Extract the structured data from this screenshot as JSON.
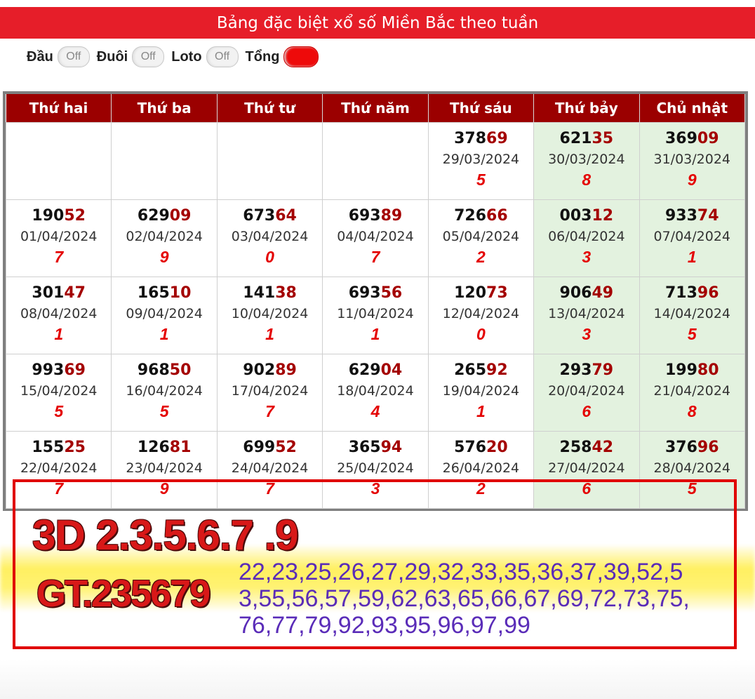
{
  "header": {
    "title": "Bảng đặc biệt xổ số Miền Bắc theo tuần"
  },
  "toggles": [
    {
      "label": "Đầu",
      "state": "Off"
    },
    {
      "label": "Đuôi",
      "state": "Off"
    },
    {
      "label": "Loto",
      "state": "Off"
    },
    {
      "label": "Tổng",
      "state": ""
    }
  ],
  "table": {
    "headers": [
      "Thứ hai",
      "Thứ ba",
      "Thứ tư",
      "Thứ năm",
      "Thứ sáu",
      "Thứ bảy",
      "Chủ nhật"
    ],
    "rows": [
      [
        {
          "head": "",
          "tail": "",
          "date": "",
          "sum": ""
        },
        {
          "head": "",
          "tail": "",
          "date": "",
          "sum": ""
        },
        {
          "head": "",
          "tail": "",
          "date": "",
          "sum": ""
        },
        {
          "head": "",
          "tail": "",
          "date": "",
          "sum": ""
        },
        {
          "head": "378",
          "tail": "69",
          "date": "29/03/2024",
          "sum": "5"
        },
        {
          "head": "621",
          "tail": "35",
          "date": "30/03/2024",
          "sum": "8"
        },
        {
          "head": "369",
          "tail": "09",
          "date": "31/03/2024",
          "sum": "9"
        }
      ],
      [
        {
          "head": "190",
          "tail": "52",
          "date": "01/04/2024",
          "sum": "7"
        },
        {
          "head": "629",
          "tail": "09",
          "date": "02/04/2024",
          "sum": "9"
        },
        {
          "head": "673",
          "tail": "64",
          "date": "03/04/2024",
          "sum": "0"
        },
        {
          "head": "693",
          "tail": "89",
          "date": "04/04/2024",
          "sum": "7"
        },
        {
          "head": "726",
          "tail": "66",
          "date": "05/04/2024",
          "sum": "2"
        },
        {
          "head": "003",
          "tail": "12",
          "date": "06/04/2024",
          "sum": "3"
        },
        {
          "head": "933",
          "tail": "74",
          "date": "07/04/2024",
          "sum": "1"
        }
      ],
      [
        {
          "head": "301",
          "tail": "47",
          "date": "08/04/2024",
          "sum": "1"
        },
        {
          "head": "165",
          "tail": "10",
          "date": "09/04/2024",
          "sum": "1"
        },
        {
          "head": "141",
          "tail": "38",
          "date": "10/04/2024",
          "sum": "1"
        },
        {
          "head": "693",
          "tail": "56",
          "date": "11/04/2024",
          "sum": "1"
        },
        {
          "head": "120",
          "tail": "73",
          "date": "12/04/2024",
          "sum": "0"
        },
        {
          "head": "906",
          "tail": "49",
          "date": "13/04/2024",
          "sum": "3"
        },
        {
          "head": "713",
          "tail": "96",
          "date": "14/04/2024",
          "sum": "5"
        }
      ],
      [
        {
          "head": "993",
          "tail": "69",
          "date": "15/04/2024",
          "sum": "5"
        },
        {
          "head": "968",
          "tail": "50",
          "date": "16/04/2024",
          "sum": "5"
        },
        {
          "head": "902",
          "tail": "89",
          "date": "17/04/2024",
          "sum": "7"
        },
        {
          "head": "629",
          "tail": "04",
          "date": "18/04/2024",
          "sum": "4"
        },
        {
          "head": "265",
          "tail": "92",
          "date": "19/04/2024",
          "sum": "1"
        },
        {
          "head": "293",
          "tail": "79",
          "date": "20/04/2024",
          "sum": "6"
        },
        {
          "head": "199",
          "tail": "80",
          "date": "21/04/2024",
          "sum": "8"
        }
      ],
      [
        {
          "head": "155",
          "tail": "25",
          "date": "22/04/2024",
          "sum": "7"
        },
        {
          "head": "126",
          "tail": "81",
          "date": "23/04/2024",
          "sum": "9"
        },
        {
          "head": "699",
          "tail": "52",
          "date": "24/04/2024",
          "sum": "7"
        },
        {
          "head": "365",
          "tail": "94",
          "date": "25/04/2024",
          "sum": "3"
        },
        {
          "head": "576",
          "tail": "20",
          "date": "26/04/2024",
          "sum": "2"
        },
        {
          "head": "258",
          "tail": "42",
          "date": "27/04/2024",
          "sum": "6"
        },
        {
          "head": "376",
          "tail": "96",
          "date": "28/04/2024",
          "sum": "5"
        }
      ]
    ]
  },
  "annotation": {
    "line1": "3D 2.3.5.6.7 .9",
    "line2": "GT.235679",
    "numbers": "22,23,25,26,27,29,32,33,35,36,37,39,52,53,55,56,57,59,62,63,65,66,67,69,72,73,75,76,77,79,92,93,95,96,97,99"
  },
  "colors": {
    "title_bar": "#e61e29",
    "header_bg": "#9b0000",
    "weekend_bg": "#e3f2df",
    "tail_color": "#a40000",
    "sum_color": "#e40000",
    "annotation_red": "#d81818",
    "annotation_purple": "#5a2cb8"
  }
}
